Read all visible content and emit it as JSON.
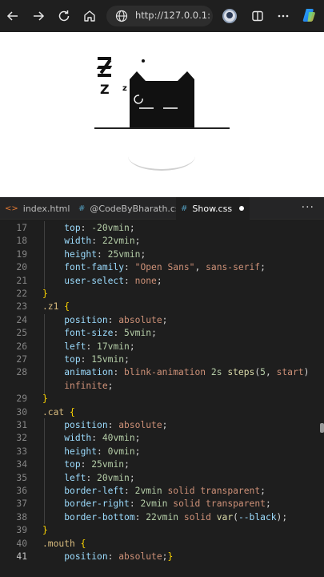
{
  "browser": {
    "url": "http://127.0.0.1:...",
    "icons": [
      "back-arrow-icon",
      "forward-arrow-icon",
      "refresh-icon",
      "home-icon",
      "globe-icon",
      "profile-avatar",
      "split-screen-icon",
      "more-options-icon",
      "copilot-icon"
    ]
  },
  "preview": {
    "z_small1": "Z",
    "z_small2": "z"
  },
  "editor": {
    "tabs": [
      {
        "label": "index.html",
        "icon": "<>",
        "dirty": true,
        "active": false
      },
      {
        "label": "@CodeByBharath.css",
        "icon": "#",
        "dirty": true,
        "active": false
      },
      {
        "label": "Show.css",
        "icon": "#",
        "dirty": true,
        "active": true
      }
    ],
    "more_label": "···",
    "lines": [
      {
        "n": "17",
        "t": [
          [
            "  ",
            ""
          ],
          [
            "top",
            ""
          ],
          [
            ": ",
            ""
          ],
          [
            "-20",
            ""
          ],
          [
            "vmin",
            ""
          ],
          [
            ";",
            ""
          ]
        ]
      },
      {
        "n": "18"
      },
      {
        "n": "19"
      },
      {
        "n": "20"
      },
      {
        "n": "21"
      },
      {
        "n": "22"
      },
      {
        "n": "23"
      },
      {
        "n": "24"
      },
      {
        "n": "25"
      },
      {
        "n": "26"
      },
      {
        "n": "27"
      },
      {
        "n": "28"
      },
      {
        "n": ""
      },
      {
        "n": "29"
      },
      {
        "n": "30"
      },
      {
        "n": "31"
      },
      {
        "n": "32"
      },
      {
        "n": "33"
      },
      {
        "n": "34"
      },
      {
        "n": "35"
      },
      {
        "n": "36"
      },
      {
        "n": "37"
      },
      {
        "n": "38"
      },
      {
        "n": "39"
      },
      {
        "n": "40"
      },
      {
        "n": "41"
      }
    ],
    "code": [
      "    top: -20vmin;",
      "    width: 22vmin;",
      "    height: 25vmin;",
      "    font-family: \"Open Sans\", sans-serif;",
      "    user-select: none;",
      "}",
      ".z1 {",
      "    position: absolute;",
      "    font-size: 5vmin;",
      "    left: 17vmin;",
      "    top: 15vmin;",
      "    animation: blink-animation 2s steps(5, start)",
      "    infinite;",
      "}",
      ".cat {",
      "    position: absolute;",
      "    width: 40vmin;",
      "    height: 0vmin;",
      "    top: 25vmin;",
      "    left: 20vmin;",
      "    border-left: 2vmin solid transparent;",
      "    border-right: 2vmin solid transparent;",
      "    border-bottom: 22vmin solid var(--black);",
      "}",
      ".mouth {",
      "    position: absolute;"
    ]
  }
}
